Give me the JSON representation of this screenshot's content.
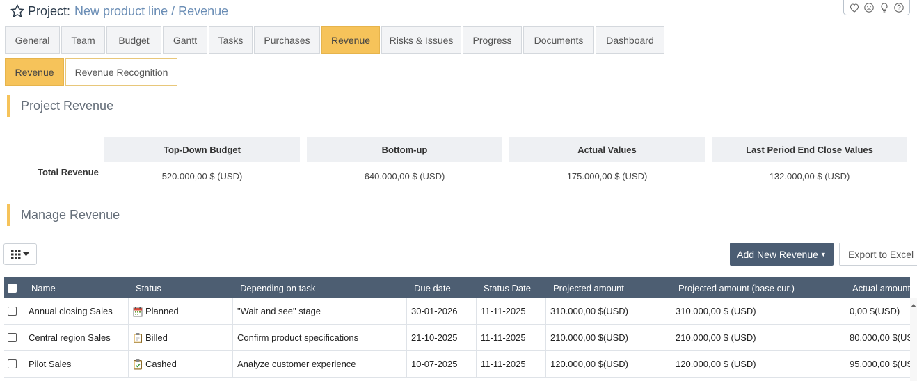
{
  "header": {
    "prefix": "Project:",
    "name": "New product line / Revenue"
  },
  "top_icons": [
    "heart-icon",
    "sad-face-icon",
    "lightbulb-icon",
    "help-icon"
  ],
  "tabs": [
    {
      "label": "General"
    },
    {
      "label": "Team"
    },
    {
      "label": "Budget"
    },
    {
      "label": "Gantt"
    },
    {
      "label": "Tasks"
    },
    {
      "label": "Purchases"
    },
    {
      "label": "Revenue",
      "active": true
    },
    {
      "label": "Risks & Issues"
    },
    {
      "label": "Progress"
    },
    {
      "label": "Documents"
    },
    {
      "label": "Dashboard"
    }
  ],
  "subtabs": [
    {
      "label": "Revenue",
      "active": true
    },
    {
      "label": "Revenue Recognition"
    }
  ],
  "project_revenue": {
    "title": "Project Revenue",
    "row_label": "Total Revenue",
    "columns": [
      {
        "header": "Top-Down Budget",
        "value": "520.000,00 $ (USD)"
      },
      {
        "header": "Bottom-up",
        "value": "640.000,00 $ (USD)"
      },
      {
        "header": "Actual Values",
        "value": "175.000,00 $ (USD)"
      },
      {
        "header": "Last Period End Close Values",
        "value": "132.000,00 $ (USD)"
      }
    ]
  },
  "manage_revenue": {
    "title": "Manage Revenue",
    "add_button": "Add New Revenue",
    "export_button": "Export to Excel",
    "columns": [
      "Name",
      "Status",
      "Depending on task",
      "Due date",
      "Status Date",
      "Projected amount",
      "Projected amount (base cur.)",
      "Actual amount"
    ],
    "rows": [
      {
        "name": "Annual closing Sales",
        "status": "Planned",
        "status_icon": "calendar-icon",
        "task": "\"Wait and see\" stage",
        "due": "30-01-2026",
        "status_date": "11-11-2025",
        "projected": "310.000,00 $(USD)",
        "projected_base": "310.000,00 $ (USD)",
        "actual": "0,00 $(USD)"
      },
      {
        "name": "Central region Sales",
        "status": "Billed",
        "status_icon": "clipboard-icon",
        "task": "Confirm product specifications",
        "due": "21-10-2025",
        "status_date": "11-11-2025",
        "projected": "210.000,00 $(USD)",
        "projected_base": "210.000,00 $ (USD)",
        "actual": "80.000,00 $(US"
      },
      {
        "name": "Pilot Sales",
        "status": "Cashed",
        "status_icon": "clipboard-check-icon",
        "task": "Analyze customer experience",
        "due": "10-07-2025",
        "status_date": "11-11-2025",
        "projected": "120.000,00 $(USD)",
        "projected_base": "120.000,00 $ (USD)",
        "actual": "95.000,00 $(US"
      }
    ]
  },
  "colors": {
    "accent": "#f6c35a",
    "header_bg": "#4d5e72",
    "button_dark": "#4b5d73",
    "title_link": "#6a8db5"
  }
}
